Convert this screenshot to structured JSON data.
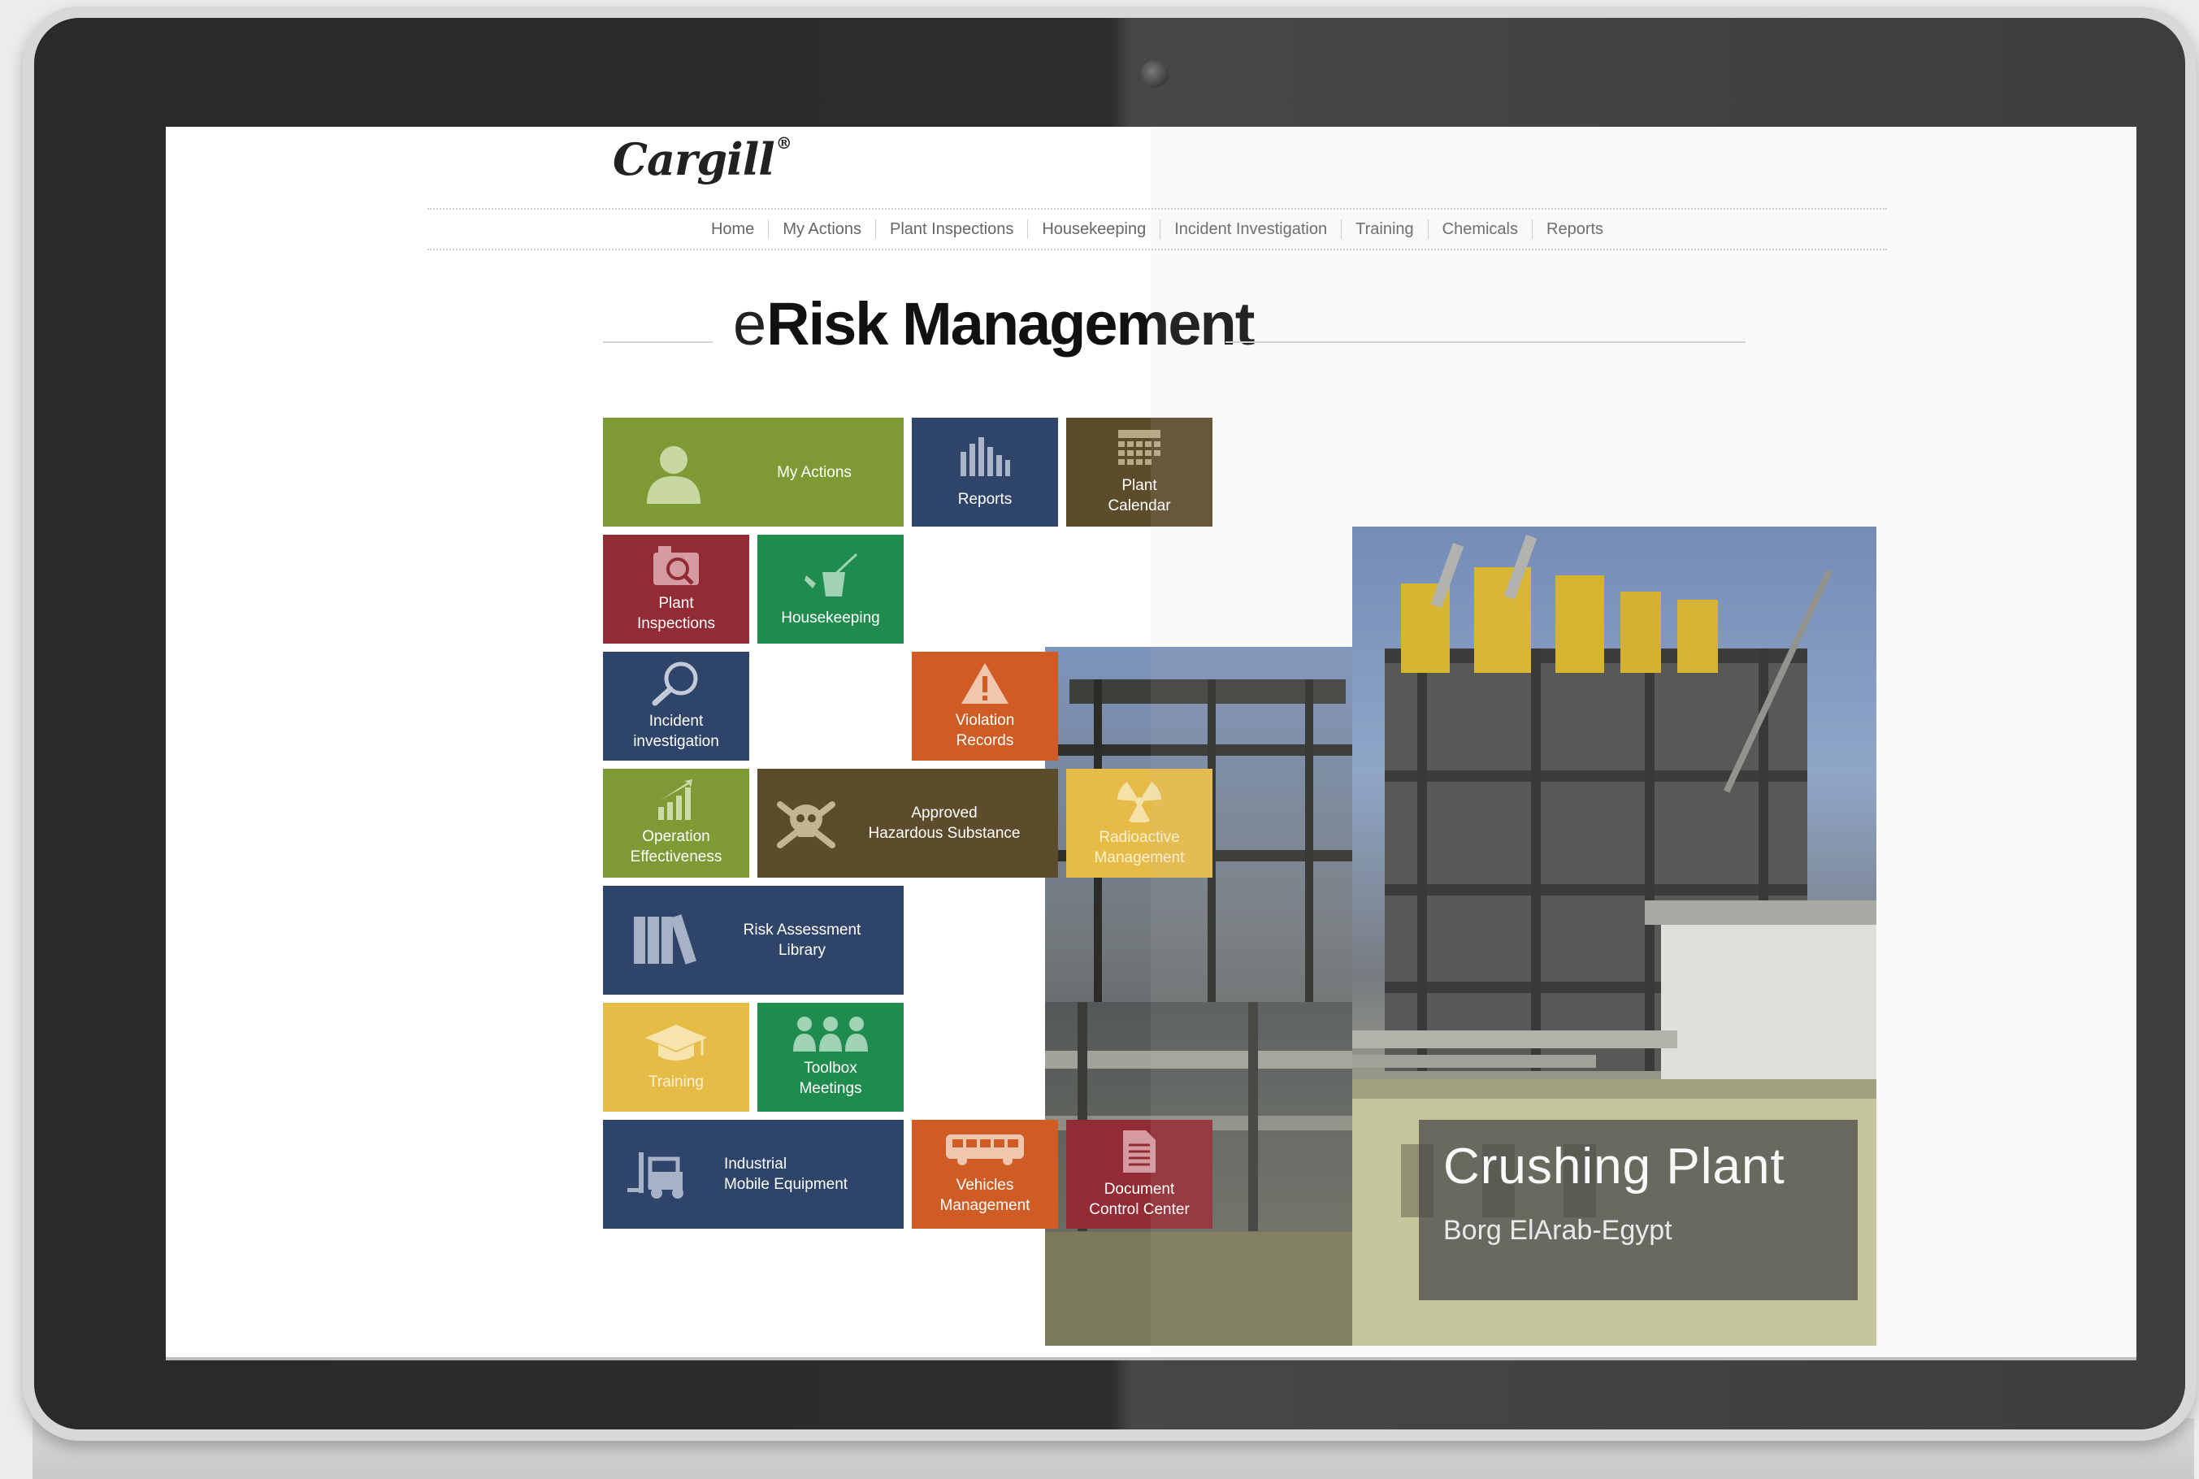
{
  "brand": {
    "logo_text": "Cargill"
  },
  "nav": {
    "items": [
      "Home",
      "My Actions",
      "Plant Inspections",
      "Housekeeping",
      "Incident Investigation",
      "Training",
      "Chemicals",
      "Reports"
    ]
  },
  "app": {
    "title_prefix": "e",
    "title_main": "Risk Management"
  },
  "tiles": {
    "my_actions": "My Actions",
    "reports": "Reports",
    "plant_calendar": [
      "Plant",
      "Calendar"
    ],
    "plant_inspections": [
      "Plant",
      "Inspections"
    ],
    "housekeeping": "Housekeeping",
    "incident_investigation": [
      "Incident",
      "investigation"
    ],
    "violation_records": [
      "Violation",
      "Records"
    ],
    "operation_effectiveness": [
      "Operation",
      "Effectiveness"
    ],
    "approved_hazardous": [
      "Approved",
      "Hazardous Substance"
    ],
    "radioactive_management": [
      "Radioactive",
      "Management"
    ],
    "risk_assessment_library": [
      "Risk Assessment",
      "Library"
    ],
    "training": "Training",
    "toolbox_meetings": [
      "Toolbox",
      "Meetings"
    ],
    "industrial_mobile_equipment": [
      "Industrial",
      "Mobile Equipment"
    ],
    "vehicles_management": [
      "Vehicles",
      "Management"
    ],
    "document_control_center": [
      "Document",
      "Control Center"
    ]
  },
  "hero": {
    "title": "Crushing Plant",
    "subtitle": "Borg ElArab-Egypt"
  },
  "colors": {
    "green": "#7d9a35",
    "navy": "#2e4468",
    "brown": "#5d4c2b",
    "red": "#922b33",
    "teal": "#1f8c4e",
    "orange": "#cf5c25",
    "yellow": "#e7bb48"
  },
  "icons": {
    "my_actions": "person-icon",
    "reports": "bar-chart-icon",
    "plant_calendar": "calendar-icon",
    "plant_inspections": "camera-magnifier-icon",
    "housekeeping": "mop-bucket-icon",
    "incident_investigation": "magnifier-icon",
    "violation_records": "warning-icon",
    "operation_effectiveness": "growth-chart-icon",
    "approved_hazardous": "skull-crossbones-icon",
    "radioactive_management": "radiation-icon",
    "risk_assessment_library": "books-icon",
    "training": "graduation-cap-icon",
    "toolbox_meetings": "group-icon",
    "industrial_mobile_equipment": "forklift-icon",
    "vehicles_management": "bus-icon",
    "document_control_center": "document-icon"
  }
}
